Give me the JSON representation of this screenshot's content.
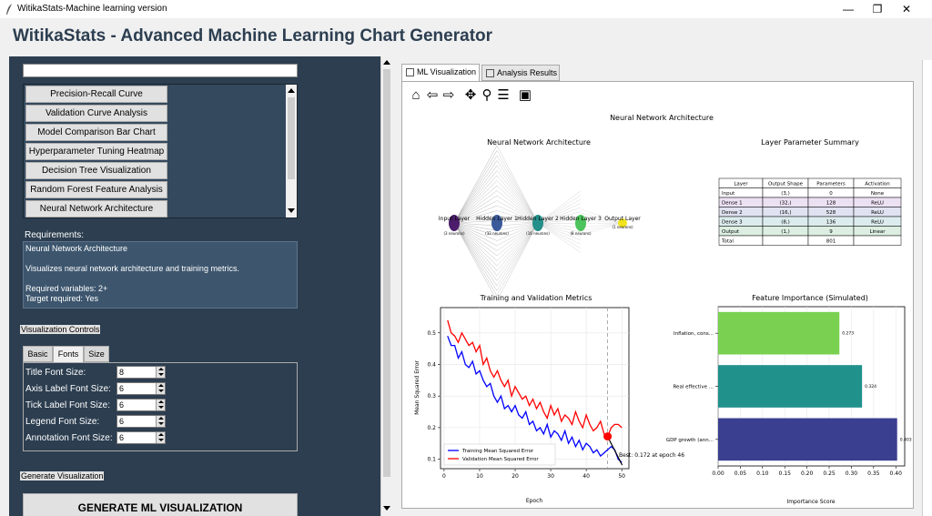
{
  "window": {
    "title": "WitikaStats-Machine learning version",
    "minimize": "—",
    "maximize": "❐",
    "close": "✕"
  },
  "header": {
    "title": "WitikaStats - Advanced Machine Learning Chart Generator"
  },
  "left": {
    "search_value": "",
    "chart_buttons": [
      "Precision-Recall Curve",
      "Validation Curve Analysis",
      "Model Comparison Bar Chart",
      "Hyperparameter Tuning Heatmap",
      "Decision Tree Visualization",
      "Random Forest Feature Analysis",
      "Neural Network Architecture"
    ],
    "requirements_label": "Requirements:",
    "requirements_lines": [
      "Neural Network Architecture",
      "",
      "Visualizes neural network architecture and training metrics.",
      "",
      "Required variables: 2+",
      "Target required: Yes"
    ],
    "controls_label": "Visualization Controls",
    "tabs": [
      "Basic",
      "Fonts",
      "Size"
    ],
    "active_tab": "Fonts",
    "font_controls": [
      {
        "label": "Title Font Size:",
        "value": "8"
      },
      {
        "label": "Axis Label Font Size:",
        "value": "6"
      },
      {
        "label": "Tick Label Font Size:",
        "value": "6"
      },
      {
        "label": "Legend Font Size:",
        "value": "6"
      },
      {
        "label": "Annotation Font Size:",
        "value": "6"
      }
    ],
    "generate_label": "Generate Visualization",
    "generate_button": "GENERATE ML VISUALIZATION"
  },
  "right": {
    "tabs": [
      "ML Visualization",
      "Analysis Results"
    ],
    "toolbar_icons": [
      "home-icon",
      "back-icon",
      "forward-icon",
      "pan-icon",
      "zoom-icon",
      "configure-icon",
      "save-icon"
    ],
    "figure": {
      "suptitle": "Neural Network Architecture",
      "nn": {
        "title": "Neural Network Architecture",
        "layers": [
          {
            "name": "Input Layer",
            "neurons": "(3 neurons)",
            "color": "#4b1d6b"
          },
          {
            "name": "Hidden Layer 1",
            "neurons": "(32 neurons)",
            "color": "#3b5a9a"
          },
          {
            "name": "Hidden Layer 2",
            "neurons": "(16 neurons)",
            "color": "#23908a"
          },
          {
            "name": "Hidden Layer 3",
            "neurons": "(8 neurons)",
            "color": "#4cc35c"
          },
          {
            "name": "Output Layer",
            "neurons": "(1 neurons)",
            "color": "#f2e51f"
          }
        ]
      },
      "table": {
        "title": "Layer Parameter Summary",
        "headers": [
          "Layer",
          "Output Shape",
          "Parameters",
          "Activation"
        ],
        "rows": [
          [
            "Input",
            "(3,)",
            "0",
            "None"
          ],
          [
            "Dense 1",
            "(32,)",
            "128",
            "ReLU"
          ],
          [
            "Dense 2",
            "(16,)",
            "528",
            "ReLU"
          ],
          [
            "Dense 3",
            "(8,)",
            "136",
            "ReLU"
          ],
          [
            "Output",
            "(1,)",
            "9",
            "Linear"
          ],
          [
            "Total",
            "",
            "801",
            ""
          ]
        ],
        "row_colors": [
          "#ffffff",
          "#ece1f3",
          "#e0e2f1",
          "#dcecee",
          "#dcefe2",
          "#ffffff"
        ]
      },
      "annotation": "Best: 0.172 at epoch 46",
      "feature_title": "Feature Importance (Simulated)",
      "feature_xlabel": "Importance Score"
    }
  },
  "chart_data": [
    {
      "type": "line",
      "title": "Training and Validation Metrics",
      "xlabel": "Epoch",
      "ylabel": "Mean Squared Error",
      "xlim": [
        -1,
        52
      ],
      "ylim": [
        0.07,
        0.58
      ],
      "xticks": [
        0,
        10,
        20,
        30,
        40,
        50
      ],
      "yticks": [
        0.1,
        0.2,
        0.3,
        0.4,
        0.5
      ],
      "grid": true,
      "legend": "lower-left",
      "best_epoch": 46,
      "best_value": 0.172,
      "x": [
        1,
        2,
        3,
        4,
        5,
        6,
        7,
        8,
        9,
        10,
        11,
        12,
        13,
        14,
        15,
        16,
        17,
        18,
        19,
        20,
        21,
        22,
        23,
        24,
        25,
        26,
        27,
        28,
        29,
        30,
        31,
        32,
        33,
        34,
        35,
        36,
        37,
        38,
        39,
        40,
        41,
        42,
        43,
        44,
        45,
        46,
        47,
        48,
        49,
        50
      ],
      "series": [
        {
          "name": "Training Mean Squared Error",
          "color": "#0000ff",
          "values": [
            0.49,
            0.46,
            0.46,
            0.42,
            0.44,
            0.4,
            0.39,
            0.41,
            0.37,
            0.38,
            0.35,
            0.33,
            0.34,
            0.3,
            0.28,
            0.3,
            0.26,
            0.27,
            0.25,
            0.27,
            0.24,
            0.23,
            0.25,
            0.21,
            0.22,
            0.19,
            0.2,
            0.18,
            0.21,
            0.17,
            0.19,
            0.18,
            0.16,
            0.19,
            0.15,
            0.17,
            0.14,
            0.16,
            0.13,
            0.15,
            0.14,
            0.12,
            0.13,
            0.11,
            0.12,
            0.13,
            0.14,
            0.13,
            0.1,
            0.09
          ]
        },
        {
          "name": "Validation Mean Squared Error",
          "color": "#ff0000",
          "values": [
            0.54,
            0.5,
            0.49,
            0.47,
            0.5,
            0.48,
            0.46,
            0.47,
            0.44,
            0.46,
            0.4,
            0.42,
            0.38,
            0.36,
            0.38,
            0.35,
            0.33,
            0.35,
            0.3,
            0.33,
            0.31,
            0.29,
            0.3,
            0.27,
            0.29,
            0.26,
            0.28,
            0.25,
            0.23,
            0.27,
            0.24,
            0.26,
            0.22,
            0.24,
            0.23,
            0.21,
            0.25,
            0.22,
            0.2,
            0.24,
            0.21,
            0.19,
            0.2,
            0.22,
            0.18,
            0.17,
            0.2,
            0.21,
            0.21,
            0.2
          ]
        }
      ]
    },
    {
      "type": "bar",
      "orientation": "horizontal",
      "title": "Feature Importance (Simulated)",
      "xlabel": "Importance Score",
      "xlim": [
        0,
        0.42
      ],
      "xticks": [
        0.0,
        0.05,
        0.1,
        0.15,
        0.2,
        0.25,
        0.3,
        0.35,
        0.4
      ],
      "categories": [
        "Inflation, cons...",
        "Real effective ...",
        "GDP growth (ann..."
      ],
      "values": [
        0.273,
        0.324,
        0.403
      ],
      "value_labels": [
        "0.273",
        "0.324",
        "0.403"
      ],
      "colors": [
        "#7ad151",
        "#21918c",
        "#3b3f8f"
      ]
    }
  ]
}
